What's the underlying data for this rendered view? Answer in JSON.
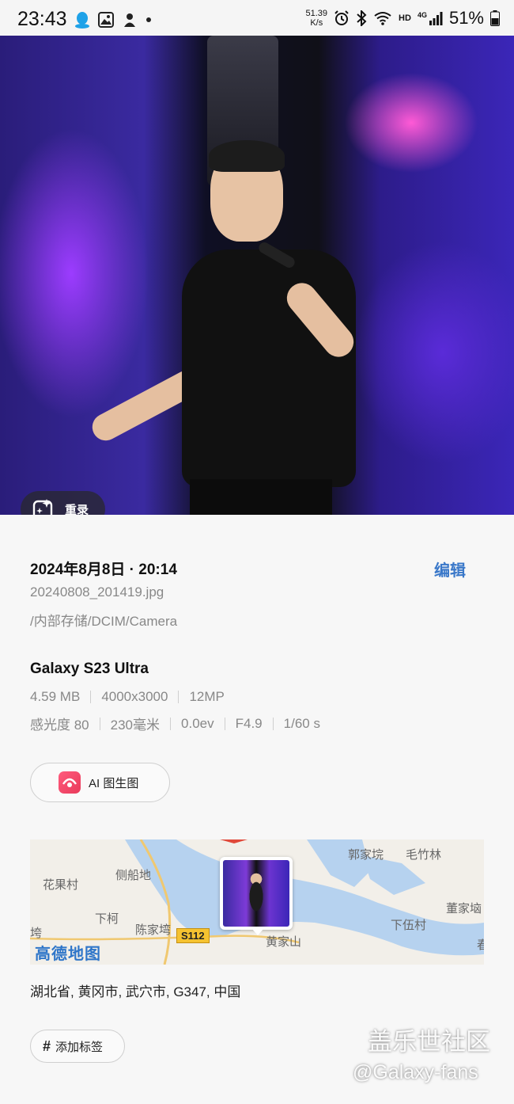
{
  "status_bar": {
    "time": "23:43",
    "left_icons": [
      "qq-icon",
      "gallery-icon",
      "app-icon",
      "dot-icon"
    ],
    "net_speed_value": "51.39",
    "net_speed_unit": "K/s",
    "network_label": "HD",
    "signal_label": "4G",
    "battery": "51%"
  },
  "photo": {
    "remaster_label": "重录"
  },
  "details": {
    "date": "2024年8月8日 · 20:14",
    "edit_label": "编辑",
    "filename": "20240808_201419.jpg",
    "path": "/内部存储/DCIM/Camera",
    "device": "Galaxy S23 Ultra",
    "specs_row1": [
      "4.59 MB",
      "4000x3000",
      "12MP"
    ],
    "specs_row2": [
      "感光度 80",
      "230毫米",
      "0.0ev",
      "F4.9",
      "1/60 s"
    ]
  },
  "ai_button": {
    "label": "AI 图生图"
  },
  "map": {
    "places": [
      "郭家垸",
      "毛竹林",
      "花果村",
      "侧船地",
      "董家垴",
      "下柯",
      "陈家塆",
      "下伍村",
      "垮",
      "黄家山",
      "春"
    ],
    "road": "S112",
    "logo": "高德地图",
    "colors": {
      "water": "#b6d2ef",
      "land": "#f2efe9",
      "road": "#f5c230"
    }
  },
  "address": "湖北省, 黄冈市, 武穴市, G347, 中国",
  "tag_button": {
    "hash": "#",
    "label": "添加标签"
  },
  "watermark": {
    "line1": "盖乐世社区",
    "line2": "@Galaxy-fans"
  }
}
